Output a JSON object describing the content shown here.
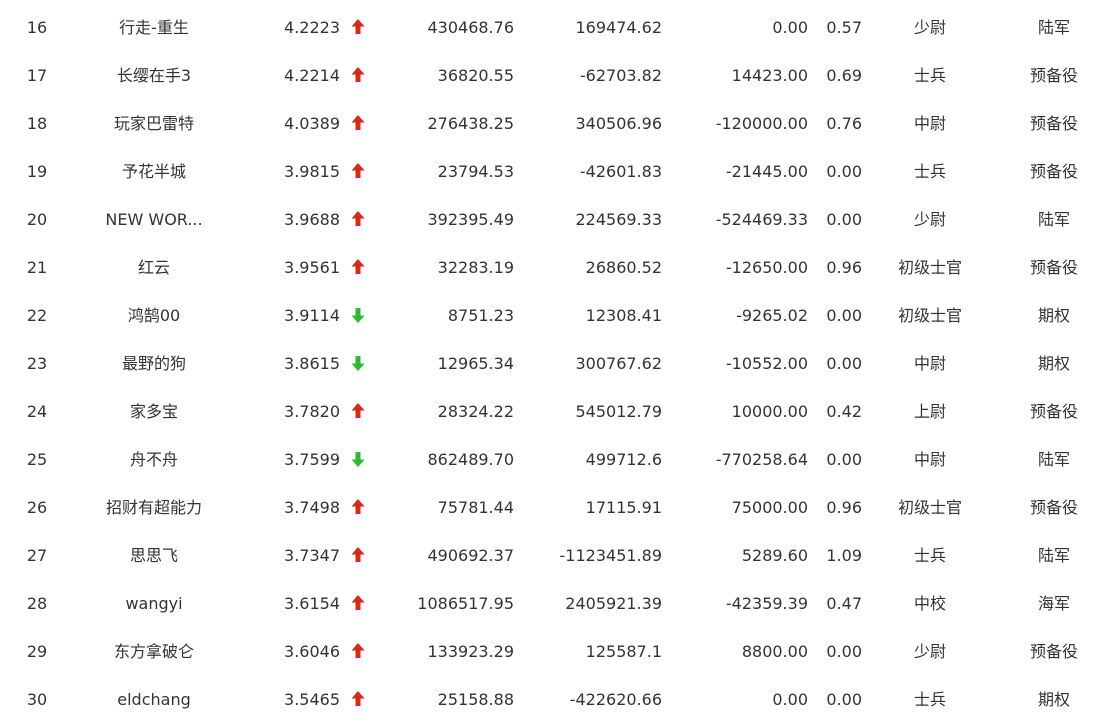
{
  "colors": {
    "up": "#e1251b",
    "down": "#2cb82f",
    "text": "#333333"
  },
  "rows": [
    {
      "rank": "16",
      "name": "行走-重生",
      "score": "4.2223",
      "trend": "up",
      "v1": "430468.76",
      "v2": "169474.62",
      "v3": "0.00",
      "v4": "0.57",
      "rank_name": "少尉",
      "branch": "陆军"
    },
    {
      "rank": "17",
      "name": "长缨在手3",
      "score": "4.2214",
      "trend": "up",
      "v1": "36820.55",
      "v2": "-62703.82",
      "v3": "14423.00",
      "v4": "0.69",
      "rank_name": "士兵",
      "branch": "预备役"
    },
    {
      "rank": "18",
      "name": "玩家巴雷特",
      "score": "4.0389",
      "trend": "up",
      "v1": "276438.25",
      "v2": "340506.96",
      "v3": "-120000.00",
      "v4": "0.76",
      "rank_name": "中尉",
      "branch": "预备役"
    },
    {
      "rank": "19",
      "name": "予花半城",
      "score": "3.9815",
      "trend": "up",
      "v1": "23794.53",
      "v2": "-42601.83",
      "v3": "-21445.00",
      "v4": "0.00",
      "rank_name": "士兵",
      "branch": "预备役"
    },
    {
      "rank": "20",
      "name": "NEW WOR...",
      "score": "3.9688",
      "trend": "up",
      "v1": "392395.49",
      "v2": "224569.33",
      "v3": "-524469.33",
      "v4": "0.00",
      "rank_name": "少尉",
      "branch": "陆军"
    },
    {
      "rank": "21",
      "name": "红云",
      "score": "3.9561",
      "trend": "up",
      "v1": "32283.19",
      "v2": "26860.52",
      "v3": "-12650.00",
      "v4": "0.96",
      "rank_name": "初级士官",
      "branch": "预备役"
    },
    {
      "rank": "22",
      "name": "鸿鹄00",
      "score": "3.9114",
      "trend": "down",
      "v1": "8751.23",
      "v2": "12308.41",
      "v3": "-9265.02",
      "v4": "0.00",
      "rank_name": "初级士官",
      "branch": "期权"
    },
    {
      "rank": "23",
      "name": "最野的狗",
      "score": "3.8615",
      "trend": "down",
      "v1": "12965.34",
      "v2": "300767.62",
      "v3": "-10552.00",
      "v4": "0.00",
      "rank_name": "中尉",
      "branch": "期权"
    },
    {
      "rank": "24",
      "name": "家多宝",
      "score": "3.7820",
      "trend": "up",
      "v1": "28324.22",
      "v2": "545012.79",
      "v3": "10000.00",
      "v4": "0.42",
      "rank_name": "上尉",
      "branch": "预备役"
    },
    {
      "rank": "25",
      "name": "舟不舟",
      "score": "3.7599",
      "trend": "down",
      "v1": "862489.70",
      "v2": "499712.6",
      "v3": "-770258.64",
      "v4": "0.00",
      "rank_name": "中尉",
      "branch": "陆军"
    },
    {
      "rank": "26",
      "name": "招财有超能力",
      "score": "3.7498",
      "trend": "up",
      "v1": "75781.44",
      "v2": "17115.91",
      "v3": "75000.00",
      "v4": "0.96",
      "rank_name": "初级士官",
      "branch": "预备役"
    },
    {
      "rank": "27",
      "name": "思思飞",
      "score": "3.7347",
      "trend": "up",
      "v1": "490692.37",
      "v2": "-1123451.89",
      "v3": "5289.60",
      "v4": "1.09",
      "rank_name": "士兵",
      "branch": "陆军"
    },
    {
      "rank": "28",
      "name": "wangyi",
      "score": "3.6154",
      "trend": "up",
      "v1": "1086517.95",
      "v2": "2405921.39",
      "v3": "-42359.39",
      "v4": "0.47",
      "rank_name": "中校",
      "branch": "海军"
    },
    {
      "rank": "29",
      "name": "东方拿破仑",
      "score": "3.6046",
      "trend": "up",
      "v1": "133923.29",
      "v2": "125587.1",
      "v3": "8800.00",
      "v4": "0.00",
      "rank_name": "少尉",
      "branch": "预备役"
    },
    {
      "rank": "30",
      "name": "eldchang",
      "score": "3.5465",
      "trend": "up",
      "v1": "25158.88",
      "v2": "-422620.66",
      "v3": "0.00",
      "v4": "0.00",
      "rank_name": "士兵",
      "branch": "期权"
    }
  ]
}
